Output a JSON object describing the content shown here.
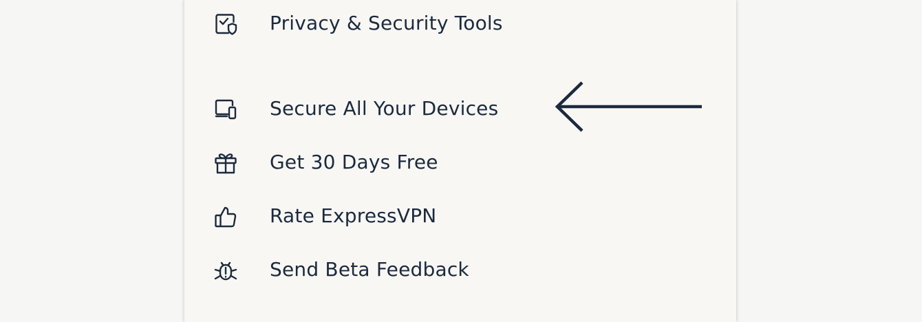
{
  "menu": {
    "items": [
      {
        "label": "Privacy & Security Tools",
        "icon": "shield-check-icon"
      },
      {
        "label": "Secure All Your Devices",
        "icon": "devices-icon"
      },
      {
        "label": "Get 30 Days Free",
        "icon": "gift-icon"
      },
      {
        "label": "Rate ExpressVPN",
        "icon": "thumbs-up-icon"
      },
      {
        "label": "Send Beta Feedback",
        "icon": "bug-icon"
      }
    ]
  },
  "annotation": {
    "icon": "arrow-left-icon"
  },
  "colors": {
    "text": "#1b2a3d",
    "panel": "#f8f7f4",
    "background": "#f6f6f4"
  }
}
